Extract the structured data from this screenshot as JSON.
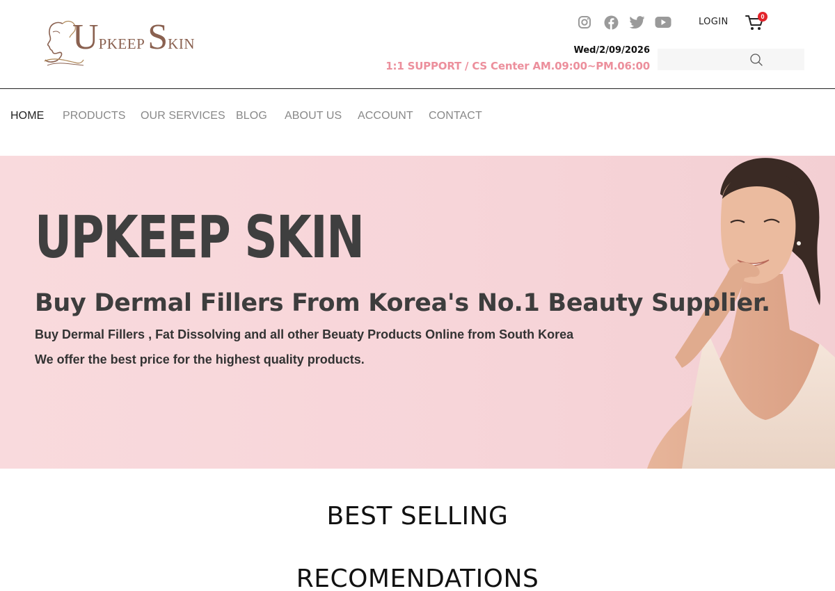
{
  "header": {
    "logo": {
      "text_big_u": "U",
      "text_pkeep": "PKEEP",
      "text_big_s": "S",
      "text_kin": "KIN"
    },
    "social": [
      {
        "name": "instagram-icon",
        "color": "#9a9a9a"
      },
      {
        "name": "facebook-icon",
        "color": "#9a9a9a"
      },
      {
        "name": "twitter-icon",
        "color": "#9a9a9a"
      },
      {
        "name": "youtube-icon",
        "color": "#9a9a9a"
      }
    ],
    "login_label": "LOGIN",
    "cart_count": "0",
    "date": "Wed/2/09/2026",
    "support": "1:1 SUPPORT / CS Center AM.09:00~PM.06:00",
    "search": {
      "placeholder": "",
      "value": ""
    },
    "accent_color": "#ec8f9c",
    "badge_color": "#e3242b"
  },
  "nav": {
    "items": [
      {
        "label": "HOME",
        "active": true
      },
      {
        "label": "PRODUCTS",
        "active": false
      },
      {
        "label": "OUR SERVICES",
        "active": false
      },
      {
        "label": "BLOG",
        "active": false
      },
      {
        "label": "ABOUT US",
        "active": false
      },
      {
        "label": "ACCOUNT",
        "active": false
      },
      {
        "label": "CONTACT",
        "active": false
      }
    ]
  },
  "hero": {
    "title": "UPKEEP SKIN",
    "subtitle": "Buy Dermal Fillers From Korea's No.1 Beauty Supplier.",
    "line1": "Buy Dermal Fillers , Fat Dissolving and all other Beuaty Products Online from South Korea",
    "line2": "We offer the best price for the highest quality products.",
    "background_color": "#f8d8db"
  },
  "sections": {
    "best_selling": "BEST SELLING",
    "recommendations": "RECOMENDATIONS"
  }
}
